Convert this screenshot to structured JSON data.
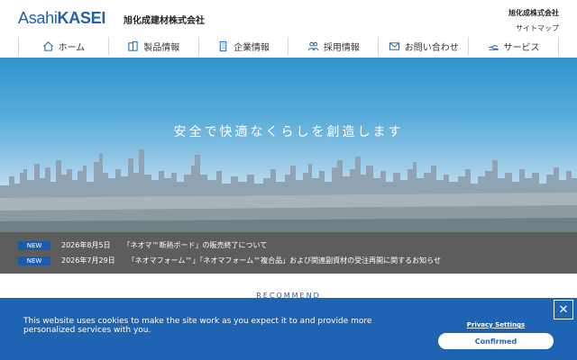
{
  "header": {
    "logo_light": "Asahi",
    "logo_bold": "KASEI",
    "company_name": "旭化成建材株式会社",
    "util_company": "旭化成株式会社",
    "util_sitemap": "サイトマップ"
  },
  "nav": {
    "items": [
      {
        "label": "ホーム",
        "icon": "home-icon"
      },
      {
        "label": "製品情報",
        "icon": "building-icon"
      },
      {
        "label": "企業情報",
        "icon": "office-icon"
      },
      {
        "label": "採用情報",
        "icon": "people-icon"
      },
      {
        "label": "お問い合わせ",
        "icon": "mail-icon"
      },
      {
        "label": "サービス",
        "icon": "service-icon"
      }
    ]
  },
  "hero": {
    "tagline": "安全で快適なくらしを創造します"
  },
  "news": [
    {
      "badge": "NEW",
      "date": "2026年8月5日",
      "title": "「ネオマ™断熱ボード」の販売終了について"
    },
    {
      "badge": "NEW",
      "date": "2026年7月29日",
      "title": "「ネオマフォーム™」「ネオマフォーム™複合品」および関連副資材の受注再開に関するお知らせ"
    }
  ],
  "section": {
    "recommend_label": "RECOMMEND"
  },
  "cookie": {
    "message": "This website uses cookies to make the site work as you expect it to and provide more personalized services with you.",
    "privacy_label": "Privacy Settings",
    "confirm_label": "Confirmed",
    "close_symbol": "✕"
  },
  "colors": {
    "brand": "#1f5fae",
    "banner": "#1f63b3",
    "news_bg": "#5d5d5d"
  }
}
